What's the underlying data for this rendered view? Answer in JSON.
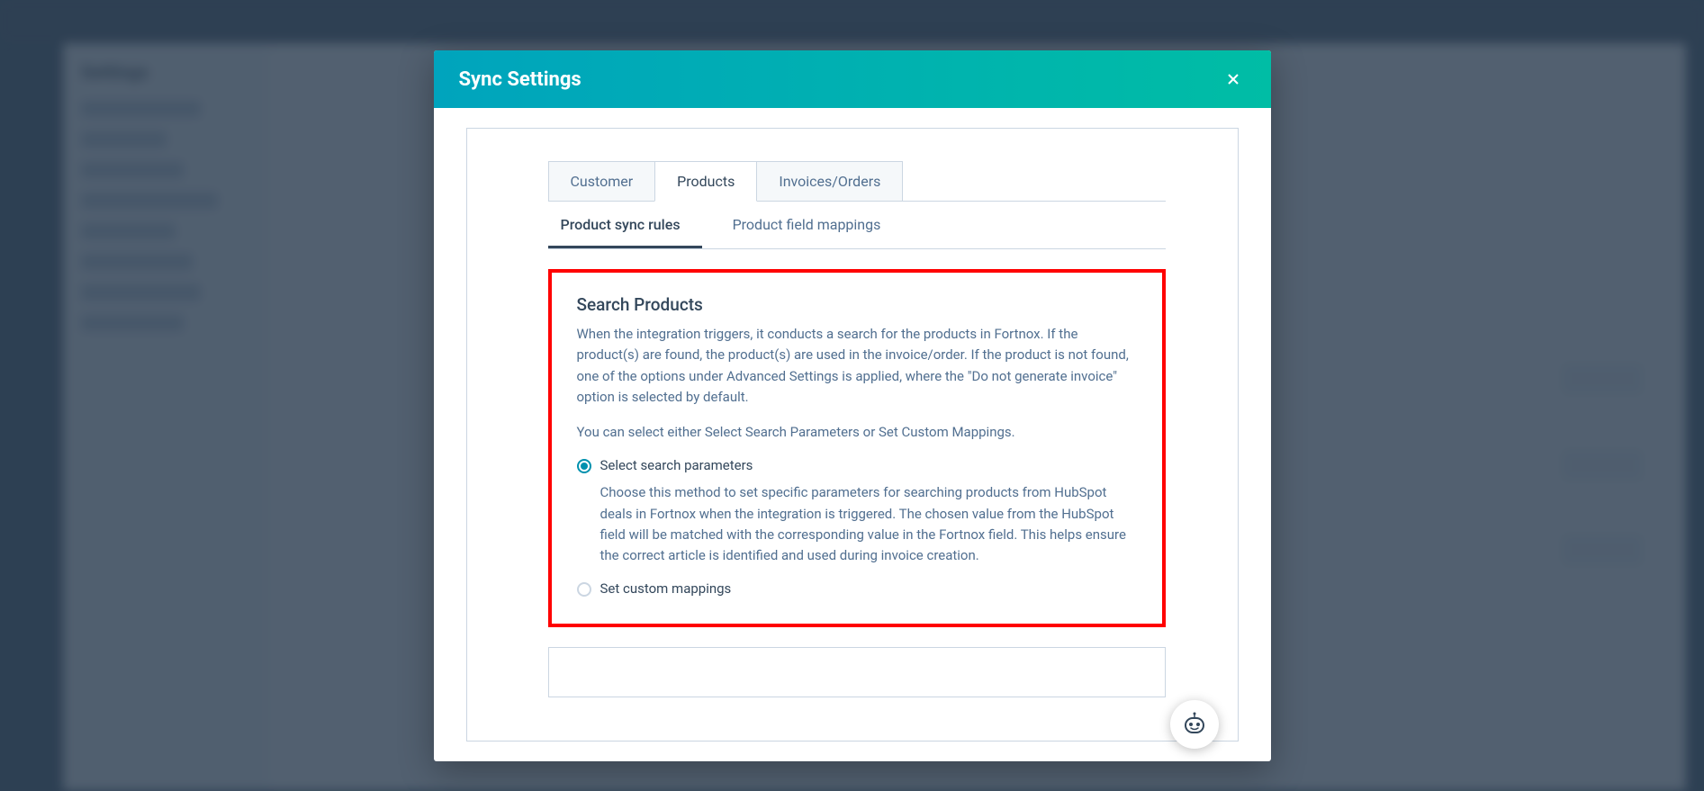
{
  "modal": {
    "title": "Sync Settings",
    "tabs": {
      "customer": "Customer",
      "products": "Products",
      "invoices": "Invoices/Orders"
    },
    "subtabs": {
      "rules": "Product sync rules",
      "mappings": "Product field mappings"
    },
    "section": {
      "title": "Search Products",
      "desc1": "When the integration triggers, it conducts a search for the products in Fortnox. If the product(s) are found, the product(s) are used in the invoice/order. If the product is not found, one of the options under Advanced Settings is applied, where the \"Do not generate invoice\" option is selected by default.",
      "desc2": "You can select either Select Search Parameters or Set Custom Mappings.",
      "radio1_label": "Select search parameters",
      "radio1_desc": "Choose this method to set specific parameters for searching products from HubSpot deals in Fortnox when the integration is triggered. The chosen value from the HubSpot field will be matched with the corresponding value in the Fortnox field. This helps ensure the correct article is identified and used during invoice creation.",
      "radio2_label": "Set custom mappings"
    }
  },
  "bg": {
    "settings_title": "Settings"
  }
}
